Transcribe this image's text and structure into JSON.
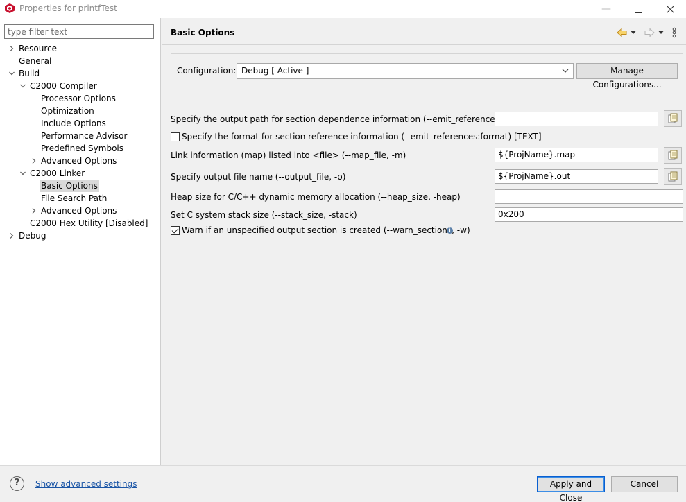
{
  "window": {
    "title": "Properties for printfTest",
    "minimize_icon": "minimize-icon",
    "maximize_icon": "maximize-icon",
    "close_icon": "close-icon"
  },
  "filter": {
    "placeholder": "type filter text",
    "value": ""
  },
  "tree": [
    {
      "label": "Resource",
      "expander": "collapsed",
      "depth": 0
    },
    {
      "label": "General",
      "expander": "none",
      "depth": 0
    },
    {
      "label": "Build",
      "expander": "expanded",
      "depth": 0
    },
    {
      "label": "C2000 Compiler",
      "expander": "expanded",
      "depth": 1
    },
    {
      "label": "Processor Options",
      "expander": "none",
      "depth": 2
    },
    {
      "label": "Optimization",
      "expander": "none",
      "depth": 2
    },
    {
      "label": "Include Options",
      "expander": "none",
      "depth": 2
    },
    {
      "label": "Performance Advisor",
      "expander": "none",
      "depth": 2
    },
    {
      "label": "Predefined Symbols",
      "expander": "none",
      "depth": 2
    },
    {
      "label": "Advanced Options",
      "expander": "collapsed",
      "depth": 2
    },
    {
      "label": "C2000 Linker",
      "expander": "expanded",
      "depth": 1
    },
    {
      "label": "Basic Options",
      "expander": "none",
      "depth": 2,
      "selected": true
    },
    {
      "label": "File Search Path",
      "expander": "none",
      "depth": 2
    },
    {
      "label": "Advanced Options",
      "expander": "collapsed",
      "depth": 2
    },
    {
      "label": "C2000 Hex Utility  [Disabled]",
      "expander": "none",
      "depth": 1
    },
    {
      "label": "Debug",
      "expander": "collapsed",
      "depth": 0
    }
  ],
  "page": {
    "title": "Basic Options",
    "configuration_label": "Configuration:",
    "configuration_value": "Debug  [ Active ]",
    "manage_button": "Manage Configurations..."
  },
  "options": {
    "emit_refs_file": {
      "label": "Specify the output path for section dependence information (--emit_references:file)",
      "value": ""
    },
    "emit_refs_format": {
      "label": "Specify the format for section reference information (--emit_references:format) [TEXT]",
      "checked": false
    },
    "map_file": {
      "label": "Link information (map) listed into <file> (--map_file, -m)",
      "value": "${ProjName}.map"
    },
    "output_file": {
      "label": "Specify output file name (--output_file, -o)",
      "value": "${ProjName}.out"
    },
    "heap_size": {
      "label": "Heap size for C/C++ dynamic memory allocation (--heap_size, -heap)",
      "value": ""
    },
    "stack_size": {
      "label": "Set C system stack size (--stack_size, -stack)",
      "value": "0x200"
    },
    "warn_sections": {
      "label": "Warn if an unspecified output section is created (--warn_sections, -w)",
      "checked": true
    }
  },
  "footer": {
    "advanced_link": "Show advanced settings",
    "apply_close": "Apply and Close",
    "cancel": "Cancel"
  },
  "colors": {
    "link": "#1a55a6",
    "selection": "#d9d9d9",
    "default_button_border": "#0a5fd0"
  }
}
